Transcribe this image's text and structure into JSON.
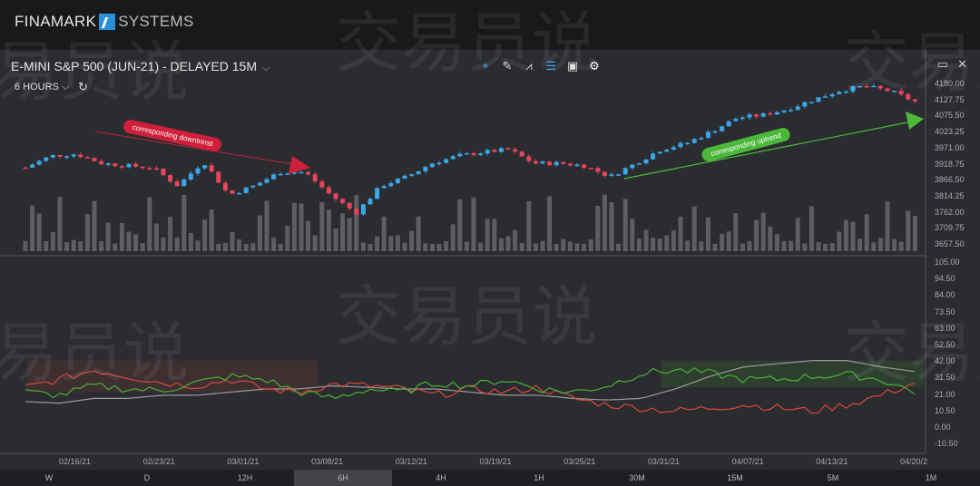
{
  "app": {
    "brand_left": "FINAMARK",
    "brand_right": "SYSTEMS"
  },
  "chart_header": {
    "title": "E-MINI S&P 500 (JUN-21) - DELAYED 15M",
    "period": "6 HOURS"
  },
  "toolbar_icons": [
    "crosshair-icon",
    "pen-icon",
    "indicator-icon",
    "layers-icon",
    "calendar-icon",
    "settings-icon"
  ],
  "watermark": "交易员说",
  "annotations": {
    "down": "corresponding downtrend",
    "up": "corresponding uptrend"
  },
  "colors": {
    "up": "#3aa7e8",
    "down": "#e8455a",
    "volume": "#6a6c70",
    "osc_red": "#d8483a",
    "osc_green": "#4caf38",
    "osc_gray": "#9a9a9a"
  },
  "price_axis": [
    "4180.00",
    "4127.75",
    "4075.50",
    "4023.25",
    "3971.00",
    "3918.75",
    "3866.50",
    "3814.25",
    "3762.00",
    "3709.75",
    "3657.50"
  ],
  "osc_axis": [
    "105.00",
    "94.50",
    "84.00",
    "73.50",
    "63.00",
    "52.50",
    "42.00",
    "31.50",
    "21.00",
    "10.50",
    "0.00",
    "-10.50"
  ],
  "dates": [
    "02/16/21",
    "02/23/21",
    "03/01/21",
    "03/08/21",
    "03/12/21",
    "03/19/21",
    "03/25/21",
    "03/31/21",
    "04/07/21",
    "04/13/21",
    "04/20/2"
  ],
  "timeframes": [
    "W",
    "D",
    "12H",
    "6H",
    "4H",
    "1H",
    "30M",
    "15M",
    "5M",
    "1M"
  ],
  "selected_timeframe": "6H",
  "chart_data": {
    "type": "candlestick",
    "price_range": [
      3657.5,
      4180
    ],
    "close_path": [
      3906,
      3944,
      3950,
      3920,
      3912,
      3906,
      3847,
      3926,
      3817,
      3847,
      3891,
      3891,
      3817,
      3758,
      3847,
      3876,
      3920,
      3944,
      3956,
      3965,
      3920,
      3920,
      3912,
      3876,
      3920,
      3965,
      3985,
      4024,
      4068,
      4077,
      4097,
      4127,
      4156,
      4171,
      4156,
      4121
    ],
    "osc_range": [
      -10.5,
      105
    ],
    "oscillator": {
      "red": [
        25,
        30,
        36,
        32,
        28,
        26,
        30,
        24,
        22,
        27,
        26,
        24,
        20,
        24,
        22,
        25,
        18,
        14,
        12,
        10,
        12,
        14,
        12,
        10,
        14,
        20,
        28
      ],
      "green": [
        22,
        20,
        26,
        24,
        23,
        28,
        32,
        30,
        22,
        18,
        24,
        22,
        28,
        26,
        30,
        24,
        22,
        26,
        34,
        36,
        34,
        30,
        30,
        32,
        33,
        30,
        22
      ],
      "gray": [
        16,
        15,
        18,
        18,
        20,
        20,
        22,
        24,
        24,
        26,
        25,
        24,
        24,
        22,
        20,
        20,
        18,
        17,
        18,
        24,
        32,
        38,
        40,
        42,
        42,
        38,
        35
      ]
    }
  }
}
